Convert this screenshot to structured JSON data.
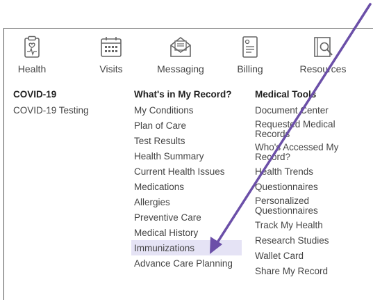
{
  "nav": {
    "tiles": [
      {
        "label": "Health",
        "icon": "clipboard-heart-icon"
      },
      {
        "label": "Visits",
        "icon": "calendar-icon"
      },
      {
        "label": "Messaging",
        "icon": "envelope-icon"
      },
      {
        "label": "Billing",
        "icon": "bill-document-icon"
      },
      {
        "label": "Resources",
        "icon": "book-search-icon"
      }
    ]
  },
  "menu": {
    "col1": {
      "heading": "COVID-19",
      "items": [
        "COVID-19 Testing"
      ]
    },
    "col2": {
      "heading": "What's in My Record?",
      "items": [
        "My Conditions",
        "Plan of Care",
        "Test Results",
        "Health Summary",
        "Current Health Issues",
        "Medications",
        "Allergies",
        "Preventive Care",
        "Medical History",
        "Immunizations",
        "Advance Care Planning"
      ],
      "highlighted": "Immunizations"
    },
    "col3": {
      "heading": "Medical Tools",
      "items": [
        "Document Center",
        "Requested Medical Records",
        "Who's Accessed My Record?",
        "Health Trends",
        "Questionnaires",
        "Personalized Questionnaires",
        "Track My Health",
        "Research Studies",
        "Wallet Card",
        "Share My Record"
      ]
    }
  },
  "annotation": {
    "arrow_color": "#6b4fa8",
    "points_to": "Immunizations"
  },
  "colors": {
    "highlight": "#e5e3f5",
    "icon_stroke": "#666666",
    "heading": "#1f1f1f",
    "text": "#444444"
  }
}
